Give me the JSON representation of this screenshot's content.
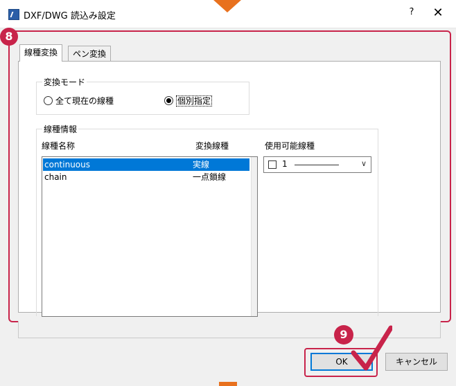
{
  "window": {
    "title": "DXF/DWG 読込み設定",
    "help": "?",
    "close": "✕"
  },
  "tabs": [
    {
      "label": "線種変換"
    },
    {
      "label": "ペン変換"
    }
  ],
  "mode_group": {
    "title": "変換モード",
    "options": [
      {
        "label": "全て現在の線種",
        "selected": false
      },
      {
        "label": "個別指定",
        "selected": true
      }
    ]
  },
  "linetype_group": {
    "title": "線種情報",
    "headers": {
      "name": "線種名称",
      "converted": "変換線種",
      "available": "使用可能線種"
    },
    "rows": [
      {
        "name": "continuous",
        "converted": "実線",
        "selected": true
      },
      {
        "name": "chain",
        "converted": "一点鎖線",
        "selected": false
      }
    ],
    "combo_value": "1"
  },
  "buttons": {
    "ok": "OK",
    "cancel": "キャンセル"
  },
  "callouts": {
    "step8": "8",
    "step9": "9"
  },
  "colors": {
    "accent": "#c8234a",
    "arrow": "#e8711e",
    "selection": "#0078d7"
  }
}
